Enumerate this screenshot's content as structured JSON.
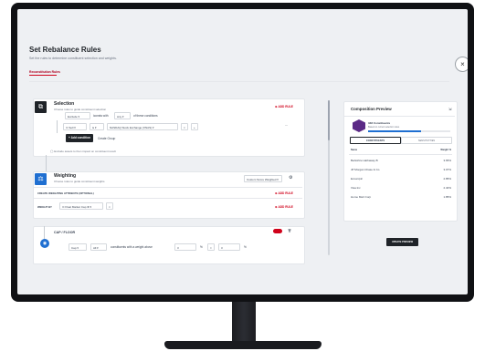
{
  "header": {
    "title": "Set Rebalance Rules",
    "subtitle": "Set the rules to determine constituent selection and weights.",
    "tab": "Reconstitution Rules",
    "close": "×"
  },
  "selection": {
    "title": "Selection",
    "subtitle": "Choose rules to guide constituent selection",
    "add_rule": "⊕ ADD RULE",
    "row1": {
      "include": "Exclude",
      "iconsts": "iconsts with",
      "any": "Any",
      "of_these": "of these conditions"
    },
    "row2": {
      "field": "Sell",
      "op": "is",
      "value": "NASDAQ Stock Exchange (XNAS)",
      "more": "···"
    },
    "add_condition": "+ Add condition",
    "create_group": "Create Group",
    "note": "Exclude assets to then impact on constituent result"
  },
  "weighting": {
    "title": "Weighting",
    "subtitle": "Choose rules to guide constituent weights",
    "dropdown": "Custom Score Weighted",
    "create_label": "CREATE WEIGHTING ATTRIBUTE (OPTIONAL)",
    "add_rule": "⊕ ADD RULE",
    "weight_by": "WEIGHT BY",
    "weight_value": "Float Market Cap",
    "add_rule2": "⊕ ADD RULE"
  },
  "cap_floor": {
    "title": "CAP / FLOOR",
    "cap": "Cap",
    "all": "All",
    "text": "constituents with a weight above",
    "v1": "3",
    "pct1": "%",
    "eq": "=",
    "v2": "3",
    "pct2": "%"
  },
  "preview": {
    "title": "Composition Preview",
    "count": "348 Constituents",
    "note": "Based on current selection rules",
    "tab1": "CONSTITUENTS",
    "tab2": "SENSITIVITIES",
    "col_name": "Name",
    "col_weight": "Weight %",
    "rows": [
      {
        "name": "Berkshire Hathaway B",
        "w": "3.65%"
      },
      {
        "name": "JP Morgan Chase & Co",
        "w": "3.07%"
      },
      {
        "name": "Exxon/plc",
        "w": "2.85%"
      },
      {
        "name": "Visa Inc",
        "w": "2.40%"
      },
      {
        "name": "Home Mart Corp",
        "w": "1.85%"
      }
    ],
    "update": "UPDATE PREVIEW"
  },
  "colors": {
    "accent": "#d0021b",
    "weighting_icon": "#1f6fd1",
    "dark": "#1f2328"
  }
}
